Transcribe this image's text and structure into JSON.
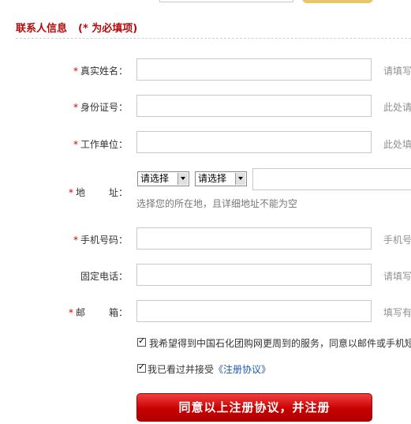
{
  "section": {
    "title": "联系人信息",
    "required_note": "(* 为必填项)"
  },
  "required_mark": "*",
  "fields": {
    "name": {
      "label": "真实姓名：",
      "hint": "请填写真实姓名"
    },
    "id_number": {
      "label": "身份证号：",
      "hint": "此处请填写身份证号"
    },
    "employer": {
      "label": "工作单位：",
      "hint": "此处填写工作单位"
    },
    "address": {
      "label_a": "地",
      "label_b": "址：",
      "province_select": "请选择",
      "city_select": "请选择",
      "note": "选择您的所在地，且详细地址不能为空"
    },
    "mobile": {
      "label": "手机号码：",
      "hint": "手机号码"
    },
    "phone": {
      "label": "固定电话：",
      "hint": "请填写固定电话"
    },
    "email": {
      "label_a": "邮",
      "label_b": "箱：",
      "hint": "填写有效邮箱"
    }
  },
  "checkboxes": {
    "subscribe": {
      "text": "我希望得到中国石化团购网更周到的服务，同意以邮件或手机短信方式接收"
    },
    "agree": {
      "text": "我已看过并接受",
      "link": "《注册协议》"
    }
  },
  "submit_label": "同意以上注册协议，并注册"
}
